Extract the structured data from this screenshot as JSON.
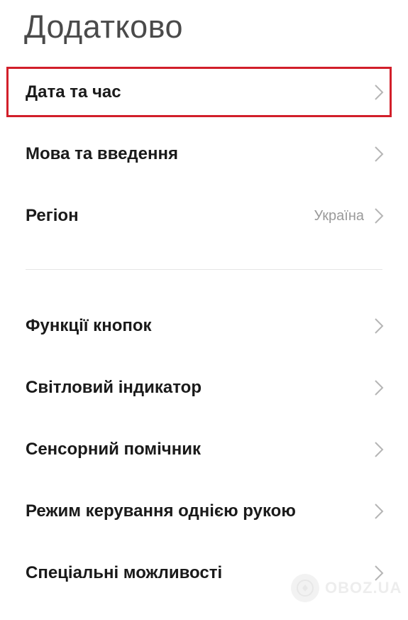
{
  "header": {
    "title": "Додатково"
  },
  "groups": [
    {
      "items": [
        {
          "label": "Дата та час",
          "value": "",
          "icon": "chevron-right-icon"
        },
        {
          "label": "Мова та введення",
          "value": "",
          "icon": "chevron-right-icon"
        },
        {
          "label": "Регіон",
          "value": "Україна",
          "icon": "chevron-right-icon"
        }
      ]
    },
    {
      "items": [
        {
          "label": "Функції кнопок",
          "value": "",
          "icon": "chevron-right-icon"
        },
        {
          "label": "Світловий індикатор",
          "value": "",
          "icon": "chevron-right-icon"
        },
        {
          "label": "Сенсорний помічник",
          "value": "",
          "icon": "chevron-right-icon"
        },
        {
          "label": "Режим керування однією рукою",
          "value": "",
          "icon": "chevron-right-icon"
        },
        {
          "label": "Спеціальні можливості",
          "value": "",
          "icon": "chevron-right-icon"
        }
      ]
    }
  ],
  "highlight": {
    "color": "#d21f2a",
    "target": "Дата та час"
  },
  "watermark": {
    "text": "OBOZ.UA"
  }
}
